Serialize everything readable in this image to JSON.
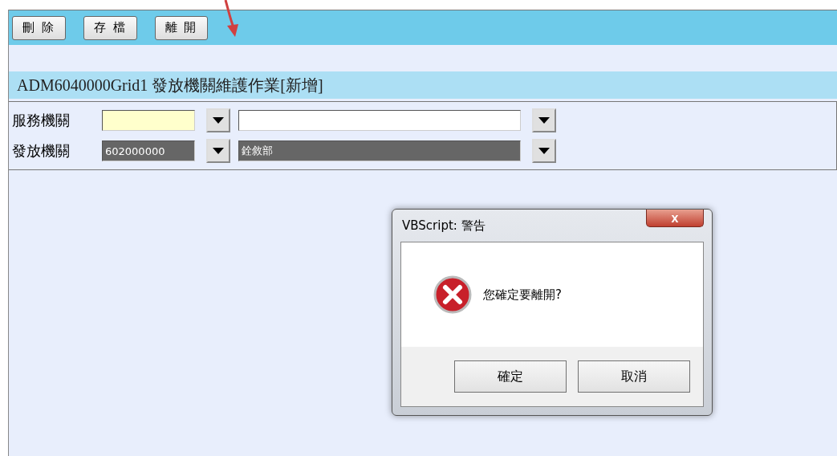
{
  "toolbar": {
    "buttons": [
      {
        "label": "刪 除"
      },
      {
        "label": "存 檔"
      },
      {
        "label": "離 開"
      }
    ]
  },
  "page_title": "ADM6040000Grid1 發放機關維護作業[新增]",
  "form": {
    "rows": [
      {
        "label": "服務機關",
        "code": "",
        "name": "",
        "disabled": false
      },
      {
        "label": "發放機關",
        "code": "602000000",
        "name": "銓敘部",
        "disabled": true
      }
    ]
  },
  "dialog": {
    "title": "VBScript: 警告",
    "close": "x",
    "message": "您確定要離開?",
    "buttons": [
      {
        "label": "確定"
      },
      {
        "label": "取消"
      }
    ]
  }
}
